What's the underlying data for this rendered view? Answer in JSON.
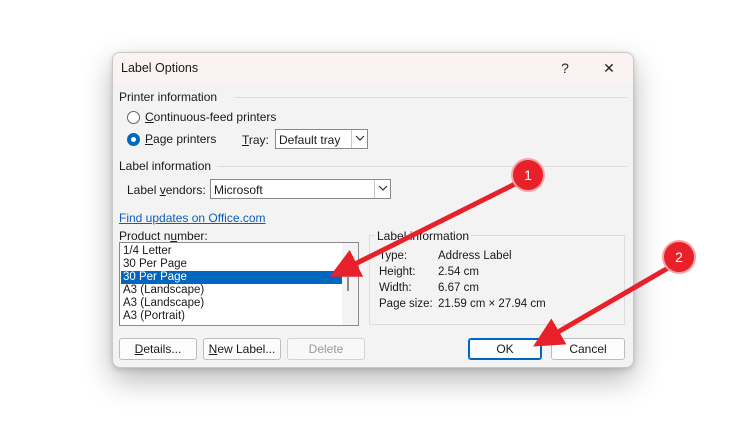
{
  "dialog": {
    "title": "Label Options",
    "help_glyph": "?",
    "close_glyph": "✕"
  },
  "printer_info": {
    "heading": "Printer information",
    "continuous_pre": "",
    "continuous_ul": "C",
    "continuous_post": "ontinuous-feed printers",
    "page_pre": "",
    "page_ul": "P",
    "page_post": "age printers",
    "tray_ul": "T",
    "tray_post": "ray:",
    "tray_value": "Default tray",
    "selected": "page"
  },
  "label_info": {
    "heading": "Label information",
    "vendors_pre": "Label ",
    "vendors_ul": "v",
    "vendors_post": "endors:",
    "vendor_value": "Microsoft",
    "find_updates": "Find updates on Office.com"
  },
  "product": {
    "label_pre": "Product n",
    "label_ul": "u",
    "label_post": "mber:",
    "items": [
      "1/4 Letter",
      "30 Per Page",
      "30 Per Page",
      "A3 (Landscape)",
      "A3 (Landscape)",
      "A3 (Portrait)"
    ],
    "selected_index": 2
  },
  "label_information": {
    "heading": "Label information",
    "rows": [
      {
        "key": "Type:",
        "value": "Address Label"
      },
      {
        "key": "Height:",
        "value": "2.54 cm"
      },
      {
        "key": "Width:",
        "value": "6.67 cm"
      },
      {
        "key": "Page size:",
        "value": "21.59 cm × 27.94 cm"
      }
    ]
  },
  "buttons": {
    "details_ul": "D",
    "details_post": "etails...",
    "new_label_ul": "N",
    "new_label_post": "ew Label...",
    "delete": "Delete",
    "ok": "OK",
    "cancel": "Cancel"
  },
  "annotations": {
    "badge1": "1",
    "badge2": "2",
    "color": "#e8202a"
  },
  "colors": {
    "accent": "#0067c0",
    "link": "#0a5fbd"
  }
}
